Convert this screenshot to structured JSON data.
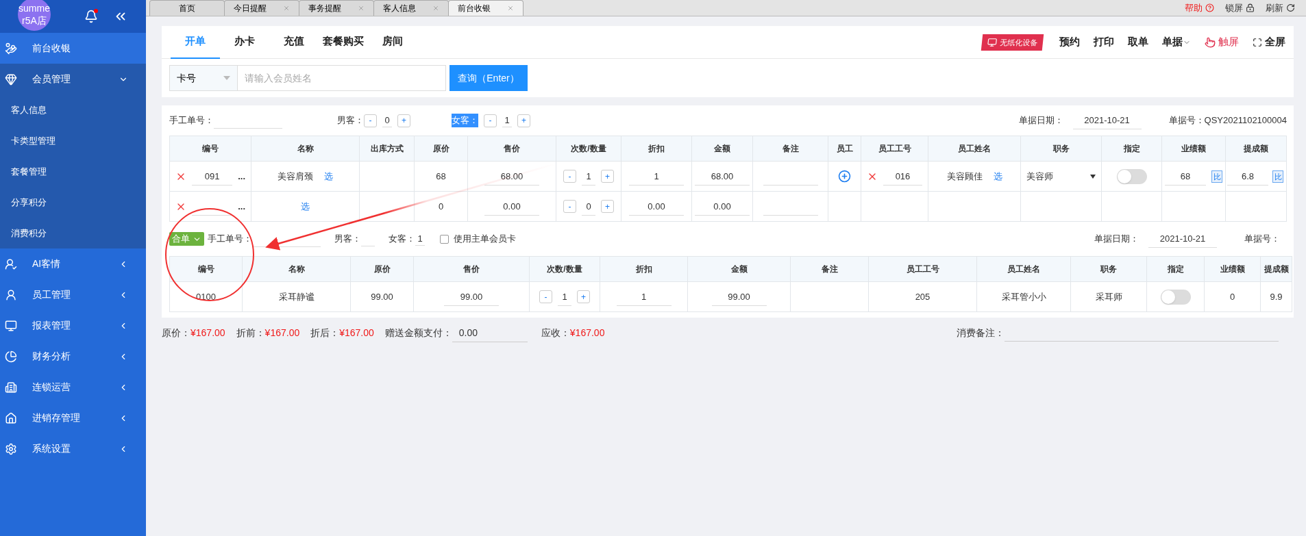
{
  "sidebar": {
    "avatar_lines": [
      "summe",
      "r5A店"
    ],
    "menu": [
      {
        "label": "前台收银",
        "selected": true,
        "expanded": false
      },
      {
        "label": "会员管理",
        "selected": false,
        "expanded": true,
        "children": [
          {
            "label": "客人信息"
          },
          {
            "label": "卡类型管理"
          },
          {
            "label": "套餐管理"
          },
          {
            "label": "分享积分"
          },
          {
            "label": "消费积分"
          }
        ]
      },
      {
        "label": "AI客情",
        "selected": false,
        "expanded": false
      },
      {
        "label": "员工管理",
        "selected": false,
        "expanded": false
      },
      {
        "label": "报表管理",
        "selected": false,
        "expanded": false
      },
      {
        "label": "财务分析",
        "selected": false,
        "expanded": false
      },
      {
        "label": "连锁运营",
        "selected": false,
        "expanded": false
      },
      {
        "label": "进销存管理",
        "selected": false,
        "expanded": false
      },
      {
        "label": "系统设置",
        "selected": false,
        "expanded": false
      }
    ]
  },
  "tabs": [
    {
      "label": "首页",
      "selected": false,
      "closable": false
    },
    {
      "label": "今日提醒",
      "selected": false,
      "closable": true
    },
    {
      "label": "事务提醒",
      "selected": false,
      "closable": true
    },
    {
      "label": "客人信息",
      "selected": false,
      "closable": true
    },
    {
      "label": "前台收银",
      "selected": true,
      "closable": true
    }
  ],
  "top_actions": [
    {
      "label": "帮助",
      "kind": "help"
    },
    {
      "label": "锁屏",
      "kind": "lock"
    },
    {
      "label": "刷新",
      "kind": "refresh"
    }
  ],
  "sub_tabs": [
    {
      "label": "开单",
      "selected": true
    },
    {
      "label": "办卡",
      "selected": false
    },
    {
      "label": "充值",
      "selected": false
    },
    {
      "label": "套餐购买",
      "selected": false
    },
    {
      "label": "房间",
      "selected": false
    }
  ],
  "toolbar": [
    {
      "kind": "device",
      "label": "无纸化设备"
    },
    {
      "kind": "plain",
      "label": "预约"
    },
    {
      "kind": "plain",
      "label": "打印"
    },
    {
      "kind": "plain",
      "label": "取单"
    },
    {
      "kind": "dropdown",
      "label": "单据"
    },
    {
      "kind": "touch",
      "label": "触屏"
    },
    {
      "kind": "fullscreen",
      "label": "全屏"
    }
  ],
  "search": {
    "select": "卡号",
    "placeholder": "请输入会员姓名",
    "button": "查询（Enter）"
  },
  "order": {
    "manual_no_label": "手工单号：",
    "male_label": "男客：",
    "male_count": "0",
    "female_label": "女客：",
    "female_highlighted": true,
    "female_count": "1",
    "minus": "-",
    "plus": "+",
    "date_label": "单据日期：",
    "date": "2021-10-21",
    "number_label": "单据号：",
    "number": "QSY2021102100004",
    "columns": [
      "编号",
      "名称",
      "出库方式",
      "原价",
      "售价",
      "次数/数量",
      "折扣",
      "金额",
      "备注",
      "员工",
      "员工工号",
      "员工姓名",
      "职务",
      "指定",
      "业绩额",
      "提成额"
    ],
    "rows": [
      [
        {
          "kind": "code",
          "value": "091",
          "more": "..."
        },
        {
          "kind": "pick",
          "value": "美容肩颈",
          "link": "选"
        },
        {
          "kind": "empty"
        },
        {
          "kind": "text",
          "value": "68"
        },
        {
          "kind": "input",
          "value": "68.00"
        },
        {
          "kind": "stepper",
          "minus": "-",
          "value": "1",
          "plus": "+"
        },
        {
          "kind": "input",
          "value": "1"
        },
        {
          "kind": "input",
          "value": "68.00"
        },
        {
          "kind": "input"
        },
        {
          "kind": "add"
        },
        {
          "kind": "code",
          "value": "016"
        },
        {
          "kind": "pick",
          "value": "美容顾佳",
          "link": "选"
        },
        {
          "kind": "select",
          "value": "美容师"
        },
        {
          "kind": "toggle",
          "on": false
        },
        {
          "kind": "ratio",
          "value": "68",
          "button": "比"
        },
        {
          "kind": "ratio",
          "value": "6.8",
          "button": "比"
        }
      ],
      [
        {
          "kind": "code",
          "more": "..."
        },
        {
          "kind": "pick",
          "link": "选"
        },
        {
          "kind": "empty"
        },
        {
          "kind": "text",
          "value": "0"
        },
        {
          "kind": "input",
          "value": "0.00"
        },
        {
          "kind": "stepper",
          "minus": "-",
          "value": "0",
          "plus": "+"
        },
        {
          "kind": "input",
          "value": "0.00"
        },
        {
          "kind": "input",
          "value": "0.00"
        },
        {
          "kind": "input"
        },
        {
          "kind": "empty"
        },
        {
          "kind": "empty"
        },
        {
          "kind": "empty"
        },
        {
          "kind": "empty"
        },
        {
          "kind": "empty"
        },
        {
          "kind": "empty"
        },
        {
          "kind": "empty"
        }
      ]
    ]
  },
  "merged_order": {
    "tag": "合单",
    "manual_no_label": "手工单号：",
    "male_label": "男客：",
    "female_label": "女客：",
    "female_count": "1",
    "use_main_card": {
      "label": "使用主单会员卡",
      "checked": false
    },
    "date_label": "单据日期：",
    "date": "2021-10-21",
    "number_label": "单据号：",
    "columns": [
      "编号",
      "名称",
      "原价",
      "售价",
      "次数/数量",
      "折扣",
      "金额",
      "备注",
      "员工工号",
      "员工姓名",
      "职务",
      "指定",
      "业绩额",
      "提成额"
    ],
    "rows": [
      [
        {
          "kind": "text",
          "value": "0100"
        },
        {
          "kind": "text",
          "value": "采耳静谧"
        },
        {
          "kind": "text",
          "value": "99.00"
        },
        {
          "kind": "input",
          "value": "99.00"
        },
        {
          "kind": "stepper",
          "minus": "-",
          "value": "1",
          "plus": "+"
        },
        {
          "kind": "input",
          "value": "1"
        },
        {
          "kind": "input",
          "value": "99.00"
        },
        {
          "kind": "empty"
        },
        {
          "kind": "text",
          "value": "205"
        },
        {
          "kind": "text",
          "value": "采耳管小小"
        },
        {
          "kind": "text",
          "value": "采耳师"
        },
        {
          "kind": "toggle",
          "on": false
        },
        {
          "kind": "text",
          "value": "0"
        },
        {
          "kind": "text",
          "value": "9.9"
        }
      ]
    ]
  },
  "totals": {
    "items": [
      {
        "label": "原价：",
        "value": "¥167.00"
      },
      {
        "label": "折前：",
        "value": "¥167.00"
      },
      {
        "label": "折后：",
        "value": "¥167.00"
      }
    ],
    "gift_label": "赠送金额支付：",
    "gift_value": "0.00",
    "due_label": "应收：",
    "due_value": "¥167.00",
    "remark_label": "消费备注："
  }
}
